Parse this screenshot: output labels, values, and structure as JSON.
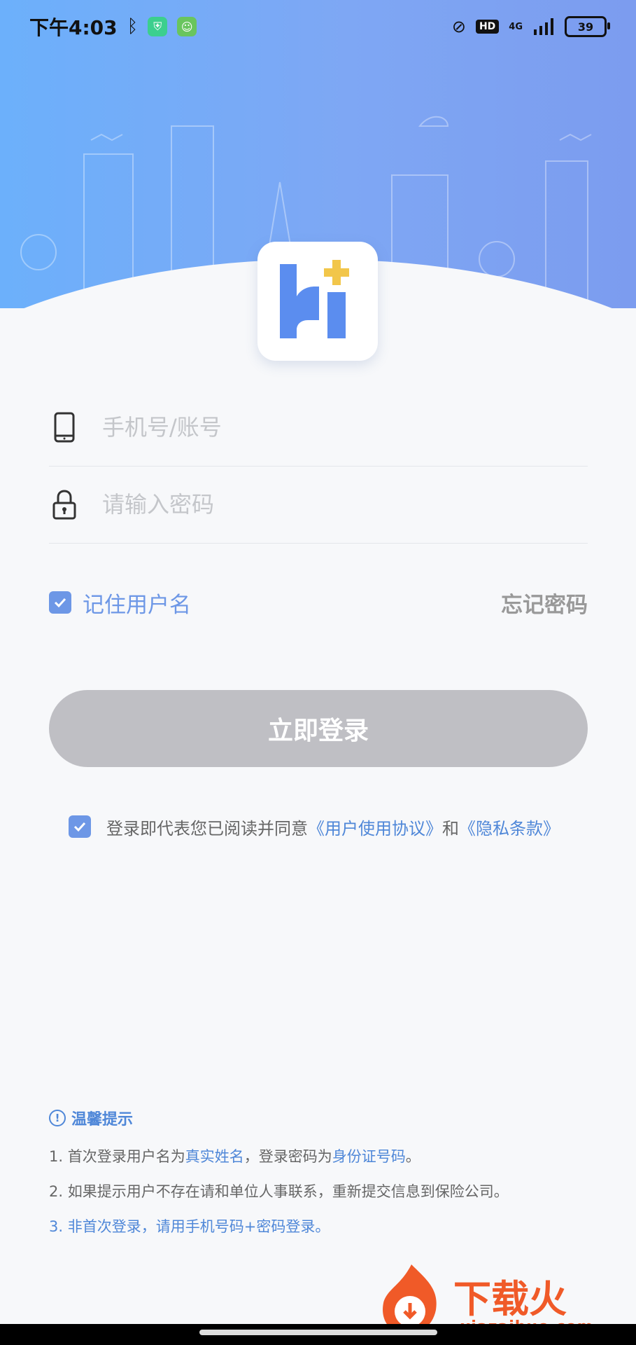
{
  "status_bar": {
    "time": "下午4:03",
    "network": "4G",
    "hd": "HD",
    "battery": "39"
  },
  "login": {
    "account_placeholder": "手机号/账号",
    "password_placeholder": "请输入密码",
    "remember_label": "记住用户名",
    "remember_checked": true,
    "forgot_label": "忘记密码",
    "submit_label": "立即登录"
  },
  "agreement": {
    "checked": true,
    "prefix": "登录即代表您已阅读并同意",
    "terms_link": "《用户使用协议》",
    "and": "和",
    "privacy_link": "《隐私条款》"
  },
  "tips": {
    "title": "温馨提示",
    "line1_a": "1. 首次登录用户名为",
    "line1_b": "真实姓名",
    "line1_c": "，登录密码为",
    "line1_d": "身份证号码",
    "line1_e": "。",
    "line2": "2. 如果提示用户不存在请和单位人事联系，重新提交信息到保险公司。",
    "line3_a": "3. ",
    "line3_b": "非首次登录，请用手机号码+密码登录。"
  },
  "watermark": {
    "brand": "下载火",
    "domain": "xiazaihuo.com"
  },
  "colors": {
    "primary": "#6d97e6",
    "link": "#4f87d8",
    "button_disabled": "#bfbfc4",
    "logo_blue": "#5b8def",
    "logo_yellow": "#f2c64a"
  }
}
